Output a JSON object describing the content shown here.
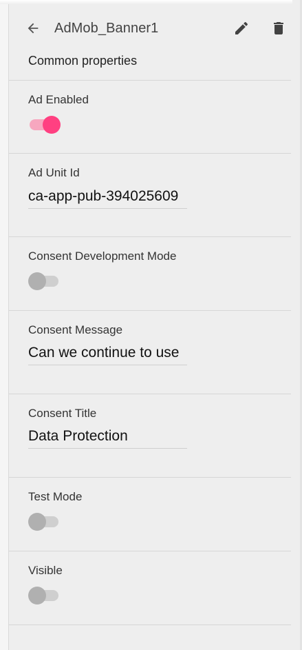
{
  "header": {
    "title": "AdMob_Banner1",
    "back_icon": "arrow-back-icon",
    "edit_icon": "pencil-icon",
    "delete_icon": "trash-icon"
  },
  "section_label": "Common properties",
  "colors": {
    "accent": "#ff4081",
    "accent_track": "#f7a7bf",
    "switch_off_thumb": "#b0b0b0",
    "switch_off_track": "#cfcfcf",
    "panel_bg": "#eeeeee"
  },
  "properties": {
    "ad_enabled": {
      "label": "Ad Enabled",
      "value": true
    },
    "ad_unit_id": {
      "label": "Ad Unit Id",
      "value": "ca-app-pub-394025609"
    },
    "consent_dev_mode": {
      "label": "Consent Development Mode",
      "value": false
    },
    "consent_message": {
      "label": "Consent Message",
      "value": "Can we continue to use"
    },
    "consent_title": {
      "label": "Consent Title",
      "value": "Data Protection"
    },
    "test_mode": {
      "label": "Test Mode",
      "value": false
    },
    "visible": {
      "label": "Visible",
      "value": false
    }
  }
}
